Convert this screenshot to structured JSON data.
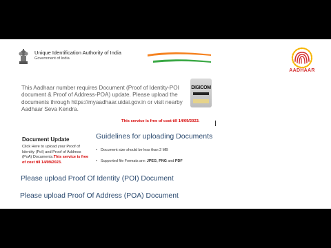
{
  "header": {
    "org_name": "Unique Identification Authority of India",
    "org_sub": "Government of India",
    "logo_wordmark": "AADHAAR",
    "colors": {
      "saffron": "#f58220",
      "green": "#3aa845",
      "logo_red": "#d32f2f"
    }
  },
  "notice": {
    "message": "This Aadhaar number requires Document (Proof of Identity-POI document & Proof of Address-POA) update. Please upload the documents through https://myaadhaar.uidai.gov.in or visit nearby Aadhaar Seva Kendra.",
    "badge_text": "DIGICOM",
    "free_note": "This service is free of cost till 14/09/2023."
  },
  "document_update": {
    "title": "Document Update",
    "description": "Click Here to upload your Proof of Identity (PoI) and Proof of Address (PoA) Documents.",
    "free_note": "This service is free of cost till 14/09/2023."
  },
  "guidelines": {
    "title": "Guidelines for uploading Documents",
    "size_text": "Document size should be less than 2 MB",
    "formats_prefix": "Supported file Formats are: ",
    "format_jpeg": "JPEG",
    "format_sep1": ", ",
    "format_png": "PNG",
    "format_sep2": " and ",
    "format_pdf": "PDF"
  },
  "upload": {
    "poi_label": "Please upload Proof Of Identity (POI) Document",
    "poa_label": "Please upload Proof Of Address (POA) Document"
  }
}
